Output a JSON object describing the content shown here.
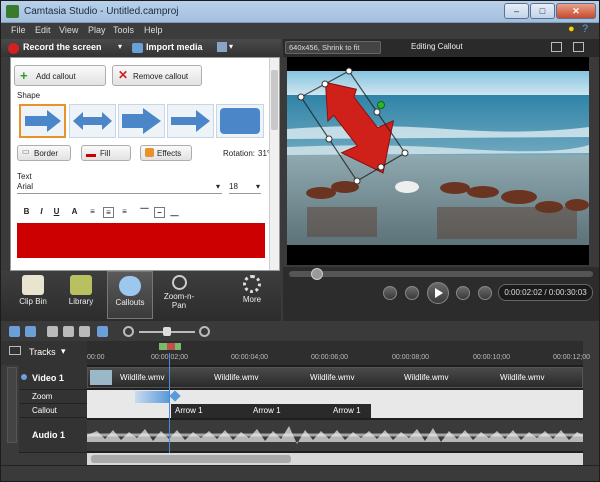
{
  "window": {
    "title": "Camtasia Studio - Untitled.camproj",
    "minimize": "–",
    "maximize": "□",
    "close": "✕"
  },
  "menu": [
    "File",
    "Edit",
    "View",
    "Play",
    "Tools",
    "Help"
  ],
  "toolbar": {
    "record_label": "Record the screen",
    "import_label": "Import media"
  },
  "callout_panel": {
    "add_label": "Add callout",
    "remove_label": "Remove callout",
    "shape_label": "Shape",
    "border_label": "Border",
    "fill_label": "Fill",
    "effects_label": "Effects",
    "rotation_label": "Rotation:",
    "rotation_value": "31°",
    "text_label": "Text",
    "font_value": "Arial",
    "size_value": "18",
    "fill_color": "#cc0000"
  },
  "tasks": [
    {
      "label": "Clip Bin",
      "icon": "clip-bin-icon"
    },
    {
      "label": "Library",
      "icon": "library-icon"
    },
    {
      "label": "Callouts",
      "icon": "callouts-icon"
    },
    {
      "label": "Zoom-n-\nPan",
      "icon": "zoom-icon"
    },
    {
      "label": "More",
      "icon": "more-icon"
    }
  ],
  "preview": {
    "size_select": "640x456, Shrink to fit",
    "mode_label": "Editing Callout"
  },
  "playback": {
    "time": "0:00:02:02 / 0:00:30:03"
  },
  "timeline": {
    "tracks_label": "Tracks",
    "ruler": [
      "00:00",
      "00:00:02;00",
      "00:00:04;00",
      "00:00:06;00",
      "00:00:08;00",
      "00:00:10;00",
      "00:00:12;00"
    ],
    "video_track": "Video 1",
    "zoom_track": "Zoom",
    "callout_track": "Callout",
    "audio_track": "Audio 1",
    "video_clips": [
      "Wildlife.wmv",
      "Wildlife.wmv",
      "Wildlife.wmv",
      "Wildlife.wmv",
      "Wildlife.wmv"
    ],
    "callout_clips": [
      "Arrow 1",
      "Arrow 1",
      "Arrow 1"
    ]
  }
}
